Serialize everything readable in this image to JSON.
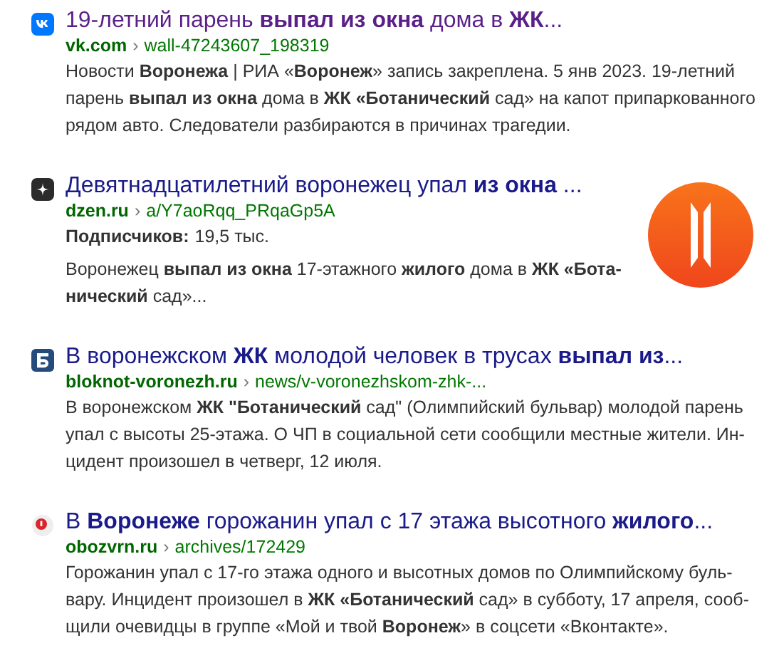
{
  "results": [
    {
      "kind": "vk",
      "visited": true,
      "title": "19-летний парень **выпал из окна** дома в **ЖК**...",
      "domain": "vk.com",
      "separator": "›",
      "path": "wall-47243607_198319",
      "snippet": [
        "Новости **Воронежа** | РИА «**Воронеж**» запись закреплена. 5 янв 2023.  19-летний",
        "парень **выпал из окна** дома в **ЖК «Ботанический** сад» на капот припаркованного",
        "рядом авто. Следователи разбираются в причинах трагедии."
      ]
    },
    {
      "kind": "dzen",
      "visited": false,
      "title": "Девятнадцатилетний воронежец упал **из окна** ...",
      "domain": "dzen.ru",
      "separator": "›",
      "path": "a/Y7aoRqq_PRqaGp5A",
      "meta_label": "Подписчиков:",
      "meta_value": "19,5 тыс.",
      "snippet": [
        "Воронежец **выпал из окна** 17-этажного **жилого** дома в **ЖК «Бота-**",
        "**нический** сад»..."
      ],
      "thumbnail": {
        "kind": "logo"
      }
    },
    {
      "kind": "bloknot",
      "visited": false,
      "title": "В воронежском **ЖК** молодой человек в трусах **выпал из**...",
      "domain": "bloknot-voronezh.ru",
      "separator": "›",
      "path": "news/v-voronezhskom-zhk-...",
      "snippet": [
        "В воронежском **ЖК \"Ботанический** сад\" (Олимпийский бульвар) молодой парень",
        "упал с высоты 25-этажа. О ЧП в социальной сети сообщили местные жители. Ин-",
        "цидент произошел в четверг, 12 июля."
      ]
    },
    {
      "kind": "oboz",
      "visited": false,
      "title": "В **Воронеже** горожанин упал с 17 этажа высотного **жилого**...",
      "domain": "obozvrn.ru",
      "separator": "›",
      "path": "archives/172429",
      "snippet": [
        "Горожанин упал с 17-го этажа одного и высотных домов по Олимпийскому буль-",
        "вару. Инцидент произошел в **ЖК «Ботанический** сад» в субботу, 17 апреля, сооб-",
        "щили очевидцы в группе «Мой и твой **Воронеж**» в соцсети «Вконтакте»."
      ]
    }
  ]
}
